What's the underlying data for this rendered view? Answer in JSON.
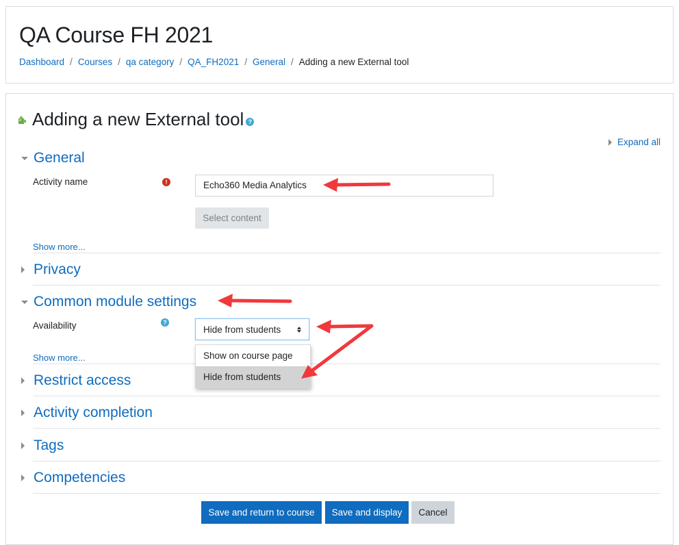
{
  "header": {
    "course_title": "QA Course FH 2021",
    "breadcrumb": [
      {
        "label": "Dashboard",
        "link": true
      },
      {
        "label": "Courses",
        "link": true
      },
      {
        "label": "qa category",
        "link": true
      },
      {
        "label": "QA_FH2021",
        "link": true
      },
      {
        "label": "General",
        "link": true
      },
      {
        "label": "Adding a new External tool",
        "link": false
      }
    ],
    "separator": "/"
  },
  "form": {
    "heading": "Adding a new External tool",
    "heading_icon": "puzzle-piece-icon",
    "help_glyph": "?",
    "expand_all": "Expand all",
    "sections": {
      "general": {
        "label": "General",
        "expanded": true
      },
      "privacy": {
        "label": "Privacy",
        "expanded": false
      },
      "common_module": {
        "label": "Common module settings",
        "expanded": true
      },
      "restrict_access": {
        "label": "Restrict access",
        "expanded": false
      },
      "activity_completion": {
        "label": "Activity completion",
        "expanded": false
      },
      "tags": {
        "label": "Tags",
        "expanded": false
      },
      "competencies": {
        "label": "Competencies",
        "expanded": false
      }
    },
    "activity_name": {
      "label": "Activity name",
      "required_glyph": "!",
      "value": "Echo360 Media Analytics"
    },
    "select_content": "Select content",
    "show_more": "Show more...",
    "availability": {
      "label": "Availability",
      "value": "Hide from students",
      "options": [
        "Show on course page",
        "Hide from students"
      ],
      "highlighted_option": "Hide from students"
    },
    "buttons": {
      "save_return": "Save and return to course",
      "save_display": "Save and display",
      "cancel": "Cancel"
    }
  },
  "annotations": {
    "arrow_color": "#f0393d"
  },
  "colors": {
    "link": "#0f6cbf",
    "primary": "#0f6cbf",
    "required": "#ca3120",
    "help": "#3fa8d6"
  }
}
